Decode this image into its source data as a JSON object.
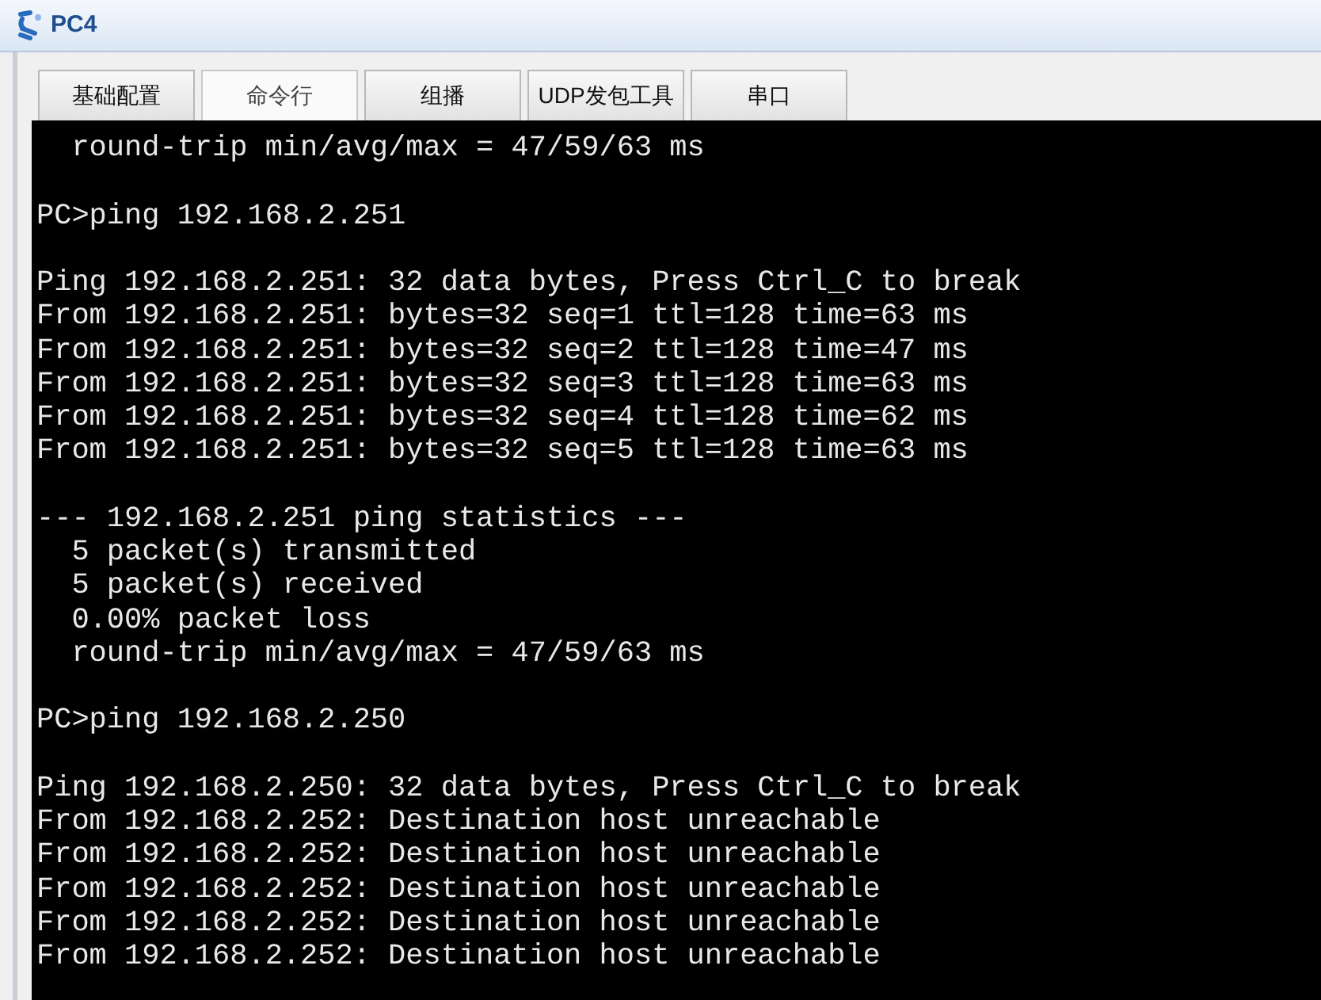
{
  "window": {
    "title": "PC4"
  },
  "tabs": [
    {
      "label": "基础配置",
      "selected": false
    },
    {
      "label": "命令行",
      "selected": true
    },
    {
      "label": "组播",
      "selected": false
    },
    {
      "label": "UDP发包工具",
      "selected": false
    },
    {
      "label": "串口",
      "selected": false
    }
  ],
  "terminal": {
    "blocks": [
      [
        "  round-trip min/avg/max = 47/59/63 ms"
      ],
      [
        "PC>ping 192.168.2.251"
      ],
      [
        "Ping 192.168.2.251: 32 data bytes, Press Ctrl_C to break",
        "From 192.168.2.251: bytes=32 seq=1 ttl=128 time=63 ms",
        "From 192.168.2.251: bytes=32 seq=2 ttl=128 time=47 ms",
        "From 192.168.2.251: bytes=32 seq=3 ttl=128 time=63 ms",
        "From 192.168.2.251: bytes=32 seq=4 ttl=128 time=62 ms",
        "From 192.168.2.251: bytes=32 seq=5 ttl=128 time=63 ms"
      ],
      [
        "--- 192.168.2.251 ping statistics ---",
        "  5 packet(s) transmitted",
        "  5 packet(s) received",
        "  0.00% packet loss",
        "  round-trip min/avg/max = 47/59/63 ms"
      ],
      [
        "PC>ping 192.168.2.250"
      ],
      [
        "Ping 192.168.2.250: 32 data bytes, Press Ctrl_C to break",
        "From 192.168.2.252: Destination host unreachable",
        "From 192.168.2.252: Destination host unreachable",
        "From 192.168.2.252: Destination host unreachable",
        "From 192.168.2.252: Destination host unreachable",
        "From 192.168.2.252: Destination host unreachable"
      ]
    ]
  }
}
